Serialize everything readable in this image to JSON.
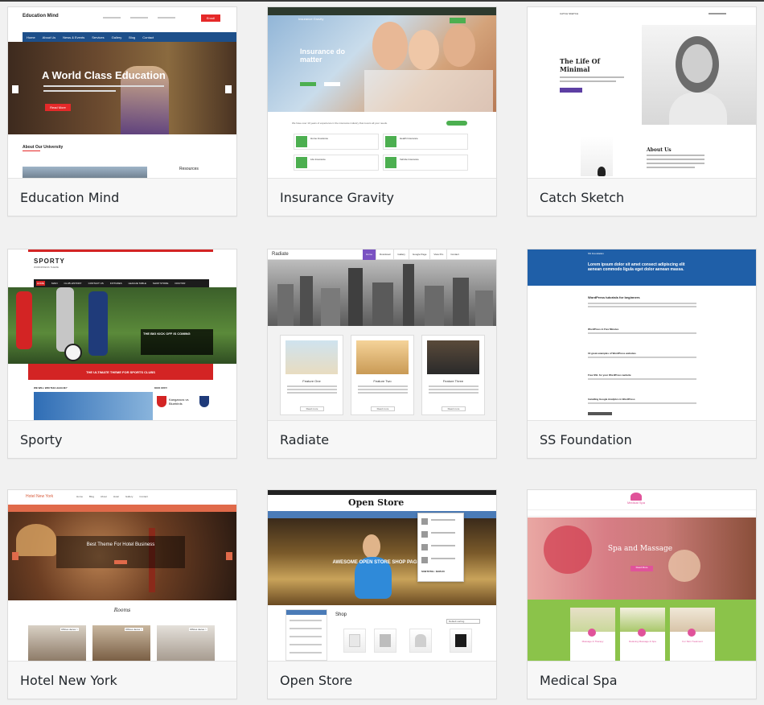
{
  "themes": [
    {
      "name": "Education Mind",
      "preview": {
        "brand": "Education Mind",
        "nav": [
          "Home",
          "About Us",
          "News & Events",
          "Services",
          "Gallery",
          "Blog",
          "Contact"
        ],
        "hero_title": "A World Class Education",
        "hero_button": "Read More",
        "section_title": "About Our University",
        "side_title": "Resources"
      }
    },
    {
      "name": "Insurance Gravity",
      "preview": {
        "brand": "Insurance Gravity",
        "hero_title": "Insurance do matter",
        "tagline": "We have over 10 years of experience in the insurance industry that covers all your needs.",
        "services": [
          "Home Insurance",
          "Health Insurance",
          "Life Insurance",
          "Vehicle Insurance"
        ]
      }
    },
    {
      "name": "Catch Sketch",
      "preview": {
        "brand": "CATCH SKETCH",
        "hero_title": "The Life Of Minimal",
        "section_title": "About Us"
      }
    },
    {
      "name": "Sporty",
      "preview": {
        "brand": "SPORTY",
        "sub": "WORDPRESS THEME",
        "nav": [
          "HOME",
          "MAIN",
          "CLUB HISTORY",
          "CONTACT US",
          "FIXTURES",
          "LEAGUE TABLE",
          "SHOP STORE",
          "DOCTOR"
        ],
        "headline": "THE BIG KICK OFF IS COMING",
        "banner": "THE ULTIMATE THEME FOR SPORTS CLUBS",
        "match": "Kangaroos vs Bluebirds",
        "left_caption": "WE WILL WIN THE LEAGUE?",
        "right_caption": "KICK OFF!!"
      }
    },
    {
      "name": "Radiate",
      "preview": {
        "brand": "Radiate",
        "nav": [
          "Home",
          "Download",
          "Gallery",
          "Google Page",
          "View Pro",
          "Contact"
        ],
        "features": [
          "Feature One",
          "Feature Two",
          "Feature Three"
        ],
        "button": "Read more"
      }
    },
    {
      "name": "SS Foundation",
      "preview": {
        "brand": "SS Foundation",
        "hero": "Lorem ipsum dolor sit amet consect adipiscing elit aenean commodo ligula eget dolor aenean massa.",
        "posts": [
          "WordPress tutorials for beginners",
          "WordPress in Five Minutes",
          "10 great examples of WordPress websites",
          "Free SSL for your WordPress website",
          "Installing Google Analytics in WordPress"
        ]
      }
    },
    {
      "name": "Hotel New York",
      "preview": {
        "brand": "Hotel New York",
        "nav": [
          "Home",
          "Blog",
          "About",
          "Hotel",
          "Gallery",
          "Contact"
        ],
        "hero_title": "Best Theme For Hotel Business",
        "section_title": "Rooms",
        "room_badge": "Offices deces >"
      }
    },
    {
      "name": "Open Store",
      "preview": {
        "brand": "Open Store",
        "hero_title": "AWESOME OPEN STORE SHOP PAGE",
        "section_title": "Shop",
        "sort": "Default sorting",
        "subtotal": "SUBTOTAL: $195.00"
      }
    },
    {
      "name": "Medical Spa",
      "preview": {
        "brand": "Medical Spa",
        "hero_title": "Spa and Massage",
        "hero_button": "Read More",
        "cards": [
          "Massage & Therapy",
          "Relaxing Massage & Spa",
          "For Skin Treatment"
        ]
      }
    }
  ]
}
